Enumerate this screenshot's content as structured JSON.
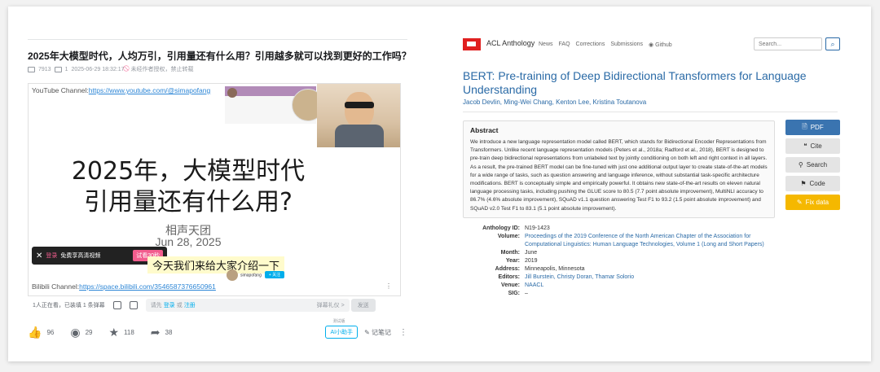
{
  "bilibili": {
    "title": "2025年大模型时代，人均万引，引用量还有什么用？引用越多就可以找到更好的工作吗？",
    "views": "7913",
    "danmaku_count": "1",
    "datetime": "2025-06-29 18:32:17",
    "no_repost": "未经作者授权，禁止转载",
    "player": {
      "youtube_label": "YouTube Channel:",
      "youtube_url": "https://www.youtube.com/@simapofang",
      "title_line1": "2025年，大模型时代",
      "title_line2": "引用量还有什么用?",
      "team": "相声天团",
      "date": "Jun 28, 2025",
      "subtitle": "今天我们来给大家介绍一下",
      "login_prefix": "登录",
      "login_text": "免费享高清视频",
      "trial": "试看30秒",
      "bilibili_label": "Bilibili Channel:",
      "bilibili_url": "https://space.bilibili.com/3546587376650961",
      "uploader": "simapofang",
      "follow": "+ 关注",
      "more": "⋮"
    },
    "danmaku_bar": {
      "watching": "1人正在看，已装填 1 条弹幕",
      "input_prefix": "请先",
      "login": "登录",
      "or": "或",
      "register": "注册",
      "etiquette": "弹幕礼仪 >",
      "send": "发送"
    },
    "actions": {
      "like": "96",
      "coin": "29",
      "favorite": "118",
      "share": "38",
      "ai_tag": "测试版",
      "ai_assistant": "AI小助手",
      "notes": "记笔记"
    }
  },
  "acl": {
    "brand": "ACL Anthology",
    "nav": [
      "News",
      "FAQ",
      "Corrections",
      "Submissions",
      "Github"
    ],
    "search_placeholder": "Search...",
    "paper_title": "BERT: Pre-training of Deep Bidirectional Transformers for Language Understanding",
    "authors": "Jacob Devlin, Ming-Wei Chang, Kenton Lee, Kristina Toutanova",
    "abstract_heading": "Abstract",
    "abstract": "We introduce a new language representation model called BERT, which stands for Bidirectional Encoder Representations from Transformers. Unlike recent language representation models (Peters et al., 2018a; Radford et al., 2018), BERT is designed to pre-train deep bidirectional representations from unlabeled text by jointly conditioning on both left and right context in all layers. As a result, the pre-trained BERT model can be fine-tuned with just one additional output layer to create state-of-the-art models for a wide range of tasks, such as question answering and language inference, without substantial task-specific architecture modifications. BERT is conceptually simple and empirically powerful. It obtains new state-of-the-art results on eleven natural language processing tasks, including pushing the GLUE score to 80.5 (7.7 point absolute improvement), MultiNLI accuracy to 86.7% (4.6% absolute improvement), SQuAD v1.1 question answering Test F1 to 93.2 (1.5 point absolute improvement) and SQuAD v2.0 Test F1 to 83.1 (5.1 point absolute improvement).",
    "buttons": {
      "pdf": "PDF",
      "cite": "Cite",
      "search": "Search",
      "code": "Code",
      "fix": "Fix data"
    },
    "meta": [
      {
        "k": "Anthology ID:",
        "v": "N19-1423",
        "link": false
      },
      {
        "k": "Volume:",
        "v": "Proceedings of the 2019 Conference of the North American Chapter of the Association for Computational Linguistics: Human Language Technologies, Volume 1 (Long and Short Papers)",
        "link": true
      },
      {
        "k": "Month:",
        "v": "June",
        "link": false
      },
      {
        "k": "Year:",
        "v": "2019",
        "link": false
      },
      {
        "k": "Address:",
        "v": "Minneapolis, Minnesota",
        "link": false
      },
      {
        "k": "Editors:",
        "v": "Jill Burstein, Christy Doran, Thamar Solorio",
        "link": true
      },
      {
        "k": "Venue:",
        "v": "NAACL",
        "link": true
      },
      {
        "k": "SIG:",
        "v": "–",
        "link": false
      }
    ]
  }
}
